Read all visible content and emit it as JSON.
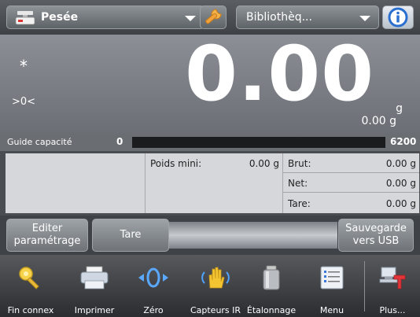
{
  "topbar": {
    "application": "Pesée",
    "library": "Bibliothèq..."
  },
  "reading": {
    "stability_indicator": "*",
    "zero_indicator": ">0<",
    "value": "0.00",
    "unit": "g",
    "secondary": "0.00 g"
  },
  "capacity": {
    "label": "Guide capacité",
    "min": "0",
    "max": "6200",
    "fill_fraction": 0
  },
  "panel": {
    "min_weight": {
      "label": "Poids mini:",
      "value": "0.00 g"
    },
    "rows": [
      {
        "label": "Brut:",
        "value": "0.00 g"
      },
      {
        "label": "Net:",
        "value": "0.00 g"
      },
      {
        "label": "Tare:",
        "value": "0.00 g"
      }
    ]
  },
  "softkeys": {
    "edit_line1": "Editer",
    "edit_line2": "paramétrage",
    "tare": "Tare",
    "usb_line1": "Sauvegarde",
    "usb_line2": "vers USB"
  },
  "toolbar": [
    {
      "label": "Fin connex",
      "icon": "key-icon"
    },
    {
      "label": "Imprimer",
      "icon": "printer-icon"
    },
    {
      "label": "Zéro",
      "icon": "zero-icon"
    },
    {
      "label": "Capteurs IR",
      "icon": "hand-sensor-icon"
    },
    {
      "label": "Étalonnage",
      "icon": "calibration-weight-icon"
    },
    {
      "label": "Menu",
      "icon": "menu-icon"
    },
    {
      "label": "Plus...",
      "icon": "more-icon"
    }
  ],
  "colors": {
    "reading_bg": "#7c8086",
    "capacity_bar": "#1b1c1e",
    "info_button": "#2a6fd0"
  }
}
